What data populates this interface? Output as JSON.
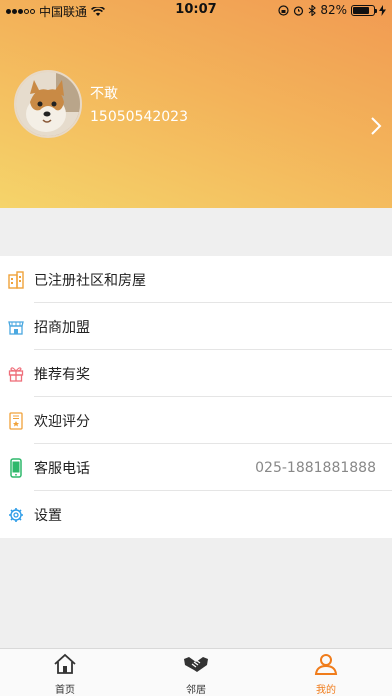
{
  "status_bar": {
    "carrier": "中国联通",
    "time": "10:07",
    "battery": "82%",
    "battery_level": 0.82
  },
  "profile": {
    "name": "不敢",
    "phone": "15050542023"
  },
  "menu": {
    "items": [
      {
        "label": "已注册社区和房屋",
        "icon": "building-icon",
        "value": ""
      },
      {
        "label": "招商加盟",
        "icon": "store-icon",
        "value": ""
      },
      {
        "label": "推荐有奖",
        "icon": "gift-icon",
        "value": ""
      },
      {
        "label": "欢迎评分",
        "icon": "certificate-icon",
        "value": ""
      },
      {
        "label": "客服电话",
        "icon": "phone-icon",
        "value": "025-1881881888"
      },
      {
        "label": "设置",
        "icon": "gear-icon",
        "value": ""
      }
    ]
  },
  "tabbar": {
    "tabs": [
      {
        "label": "首页",
        "icon": "home-icon",
        "active": false
      },
      {
        "label": "邻居",
        "icon": "handshake-icon",
        "active": false
      },
      {
        "label": "我的",
        "icon": "user-icon",
        "active": true
      }
    ]
  },
  "colors": {
    "accent": "#f07c1b",
    "header_start": "#f19a52",
    "header_end": "#f5d46a"
  }
}
